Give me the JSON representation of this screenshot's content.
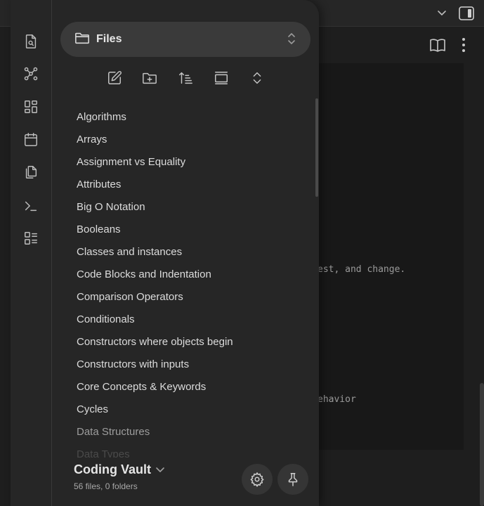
{
  "background": {
    "code_lines": [
      "est, and change.",
      "ehavior"
    ]
  },
  "ribbon": {
    "items": [
      {
        "icon": "file-search-icon"
      },
      {
        "icon": "graph-icon"
      },
      {
        "icon": "grid-icon"
      },
      {
        "icon": "calendar-icon"
      },
      {
        "icon": "copy-icon"
      },
      {
        "icon": "terminal-icon"
      },
      {
        "icon": "list-icon"
      }
    ]
  },
  "view": {
    "label": "Files"
  },
  "nav_actions": [
    {
      "icon": "new-note-icon"
    },
    {
      "icon": "new-folder-icon"
    },
    {
      "icon": "sort-icon"
    },
    {
      "icon": "auto-reveal-icon"
    },
    {
      "icon": "expand-collapse-icon"
    }
  ],
  "files": [
    "Algorithms",
    "Arrays",
    "Assignment vs Equality",
    "Attributes",
    "Big O Notation",
    "Booleans",
    "Classes and instances",
    "Code Blocks and Indentation",
    "Comparison Operators",
    "Conditionals",
    "Constructors where objects begin",
    "Constructors with inputs",
    "Core Concepts & Keywords",
    "Cycles",
    "Data Structures",
    "Data Types"
  ],
  "vault": {
    "name": "Coding Vault",
    "stats": "56 files, 0 folders"
  },
  "colors": {
    "drawer_bg": "#262626",
    "switcher_bg": "#3a3a3a",
    "text": "#dcdcdc"
  }
}
